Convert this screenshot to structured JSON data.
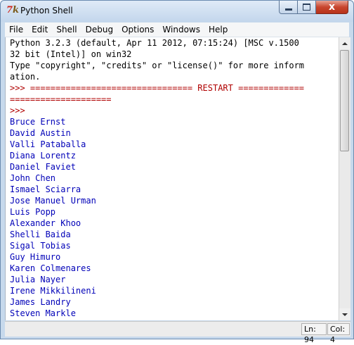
{
  "window": {
    "title": "Python Shell",
    "icon_glyph_a": "7",
    "icon_glyph_b": "k",
    "close_glyph": "x"
  },
  "menu": [
    "File",
    "Edit",
    "Shell",
    "Debug",
    "Options",
    "Windows",
    "Help"
  ],
  "shell": {
    "header": [
      "Python 3.2.3 (default, Apr 11 2012, 07:15:24) [MSC v.1500",
      "32 bit (Intel)] on win32",
      "Type \"copyright\", \"credits\" or \"license()\" for more inform",
      "ation."
    ],
    "restart_line_1": ">>> ================================ RESTART =============",
    "restart_line_2": "====================",
    "prompt": ">>>",
    "output": [
      "Bruce Ernst",
      "David Austin",
      "Valli Pataballa",
      "Diana Lorentz",
      "Daniel Faviet",
      "John Chen",
      "Ismael Sciarra",
      "Jose Manuel Urman",
      "Luis Popp",
      "Alexander Khoo",
      "Shelli Baida",
      "Sigal Tobias",
      "Guy Himuro",
      "Karen Colmenares",
      "Julia Nayer",
      "Irene Mikkilineni",
      "James Landry",
      "Steven Markle"
    ]
  },
  "status": {
    "line": "Ln: 94",
    "col": "Col: 4"
  },
  "colors": {
    "prompt": "#b00000",
    "output": "#0000b8"
  }
}
